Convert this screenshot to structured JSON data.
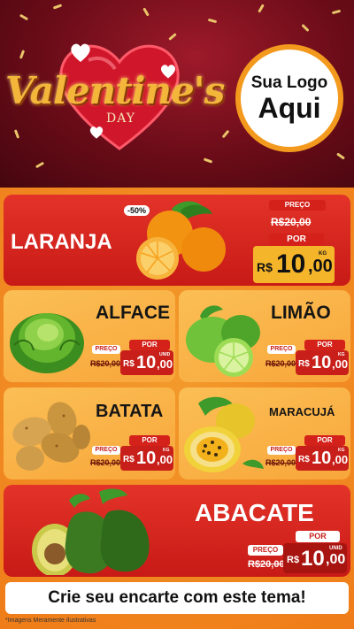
{
  "header": {
    "title": "Valentine's",
    "subtitle": "DAY",
    "logo_line1": "Sua Logo",
    "logo_line2": "Aqui"
  },
  "products": [
    {
      "name": "LARANJA",
      "badge": "-50%",
      "preco_label": "PREÇO",
      "old_price": "R$20,00",
      "por_label": "POR",
      "currency": "R$",
      "price_int": "10",
      "price_cents": ",00",
      "unit": "KG"
    },
    {
      "name": "ALFACE",
      "preco_label": "PREÇO",
      "old_price": "R$20,00",
      "por_label": "POR",
      "currency": "R$",
      "price_int": "10",
      "price_cents": ",00",
      "unit": "UNID"
    },
    {
      "name": "LIMÃO",
      "preco_label": "PREÇO",
      "old_price": "R$20,00",
      "por_label": "POR",
      "currency": "R$",
      "price_int": "10",
      "price_cents": ",00",
      "unit": "KG"
    },
    {
      "name": "BATATA",
      "preco_label": "PREÇO",
      "old_price": "R$20,00",
      "por_label": "POR",
      "currency": "R$",
      "price_int": "10",
      "price_cents": ",00",
      "unit": "KG"
    },
    {
      "name": "MARACUJÁ",
      "preco_label": "PREÇO",
      "old_price": "R$20,00",
      "por_label": "POR",
      "currency": "R$",
      "price_int": "10",
      "price_cents": ",00",
      "unit": "KG"
    },
    {
      "name": "ABACATE",
      "preco_label": "PREÇO",
      "old_price": "R$20,00",
      "por_label": "POR",
      "currency": "R$",
      "price_int": "10",
      "price_cents": ",00",
      "unit": "UNID"
    }
  ],
  "footer": {
    "cta": "Crie seu encarte com este tema!",
    "note": "*Imagens Meramente Ilustrativas"
  },
  "colors": {
    "red": "#c81f1a",
    "orange": "#f39a2c",
    "gold": "#f3b63b",
    "dark_red": "#6a0c18"
  }
}
